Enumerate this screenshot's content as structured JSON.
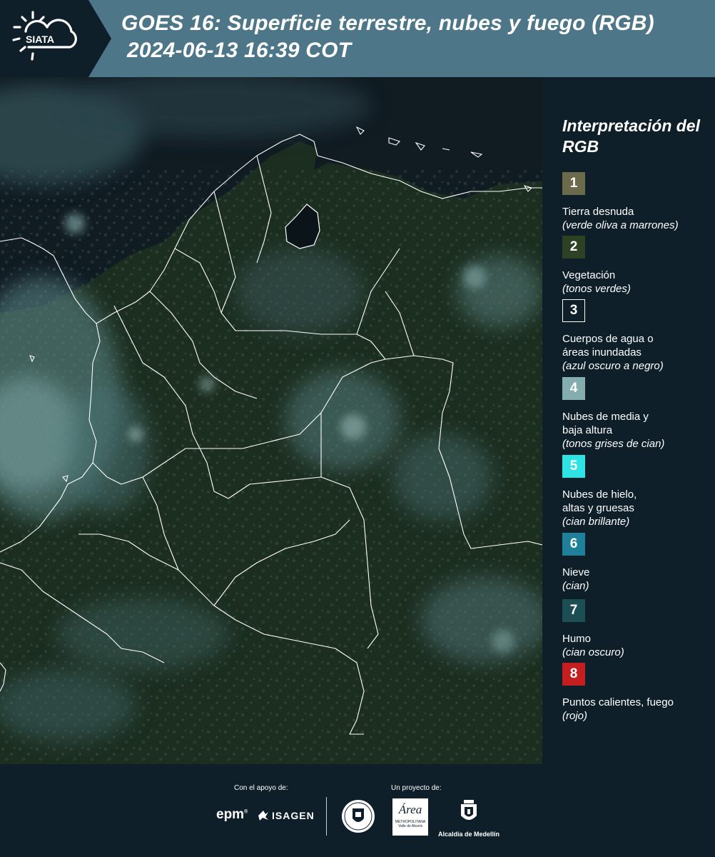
{
  "header": {
    "logo_text": "SIATA",
    "title_line1": "GOES 16: Superficie terrestre, nubes y fuego (RGB)",
    "title_line2": "2024-06-13 16:39 COT"
  },
  "map": {
    "description_icon": "satellite-rgb-map"
  },
  "legend": {
    "title": "Interpretación del RGB",
    "items": [
      {
        "num": "1",
        "label": "Tierra desnuda",
        "desc": "(verde oliva a marrones)",
        "color": "#6b6a4a"
      },
      {
        "num": "2",
        "label": "Vegetación",
        "desc": "(tonos verdes)",
        "color": "#2d4225"
      },
      {
        "num": "3",
        "label": "Cuerpos de agua o áreas inundadas",
        "desc": "(azul oscuro a negro)",
        "color": "#0e1f2a"
      },
      {
        "num": "4",
        "label": "Nubes de media y baja altura",
        "desc": "(tonos grises de cian)",
        "color": "#84aeae"
      },
      {
        "num": "5",
        "label": "Nubes de hielo, altas y gruesas",
        "desc": "(cian brillante)",
        "color": "#2ee3e3"
      },
      {
        "num": "6",
        "label": "Nieve",
        "desc": "(cian)",
        "color": "#1e8199"
      },
      {
        "num": "7",
        "label": "Humo",
        "desc": "(cian oscuro)",
        "color": "#1c4f54"
      },
      {
        "num": "8",
        "label": "Puntos calientes, fuego",
        "desc": "(rojo)",
        "color": "#c41e20"
      }
    ]
  },
  "footer": {
    "support_caption": "Con el apoyo de:",
    "project_caption": "Un proyecto de:",
    "epm_text": "epm",
    "isagen_text": "ISAGEN",
    "area_text": "Área",
    "area_sub1": "METROPOLITANA",
    "area_sub2": "Valle de Aburrá",
    "medellin_text": "Alcaldía de Medellín"
  }
}
